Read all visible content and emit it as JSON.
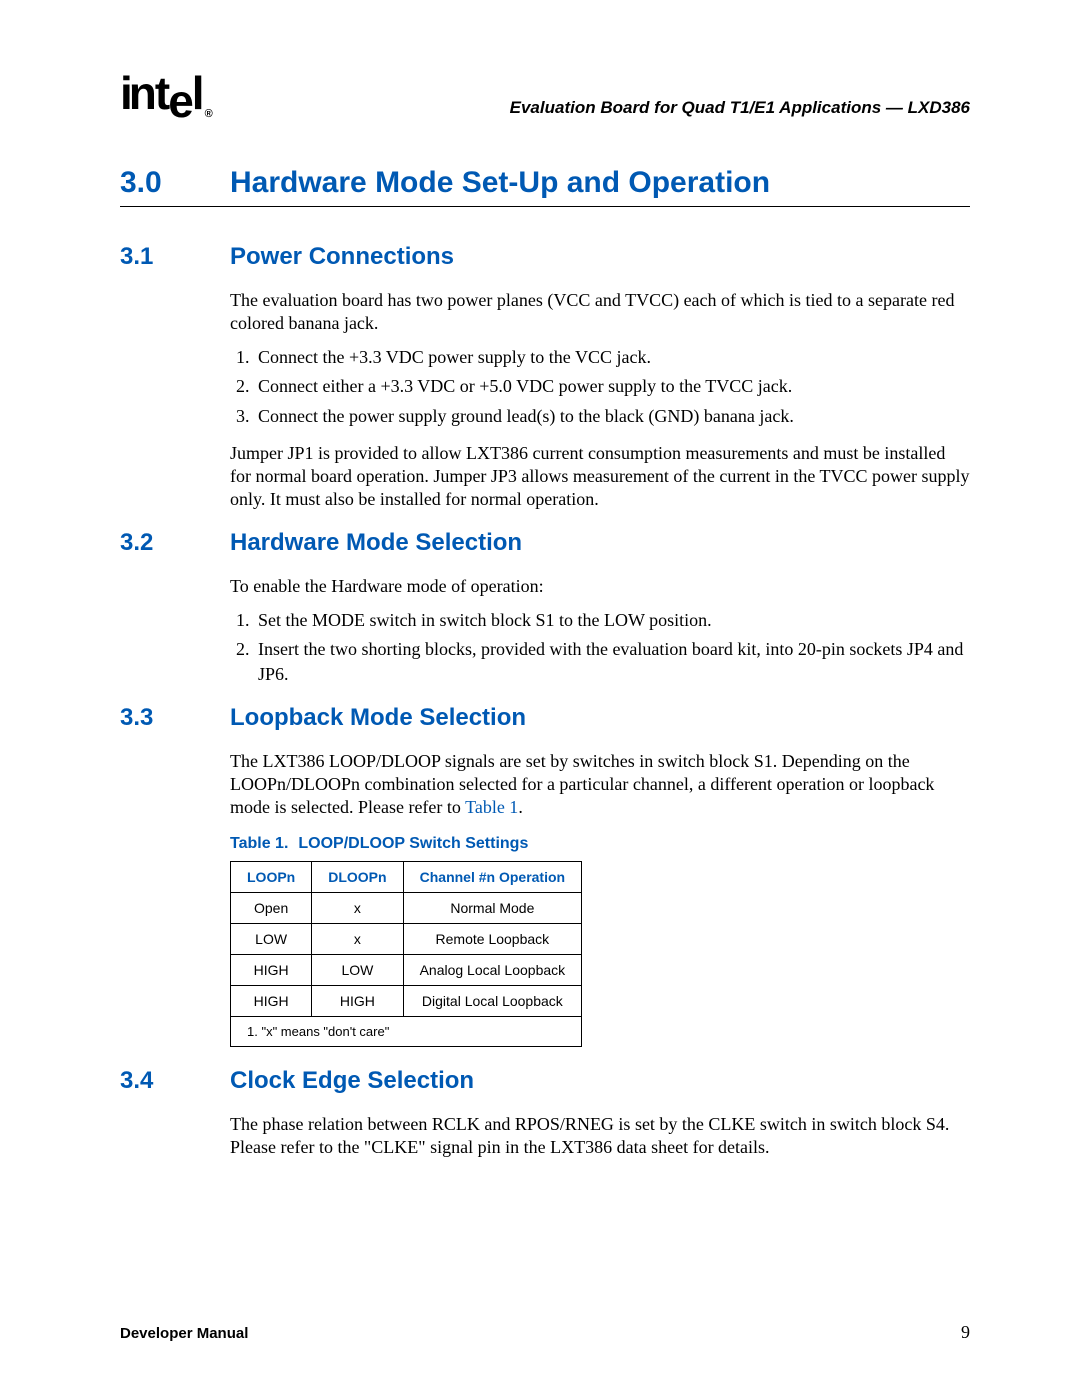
{
  "header": {
    "logo_text": "intel",
    "doc_label": "Evaluation Board for Quad T1/E1 Applications — LXD386"
  },
  "h1": {
    "num": "3.0",
    "title": "Hardware Mode Set-Up and Operation"
  },
  "s31": {
    "num": "3.1",
    "title": "Power Connections",
    "p1": "The evaluation board has two power planes (VCC and TVCC) each of which is tied to a separate red colored banana jack.",
    "steps": [
      "Connect the +3.3 VDC power supply to the VCC jack.",
      "Connect either a +3.3 VDC or +5.0 VDC power supply to the TVCC jack.",
      "Connect the power supply ground lead(s) to the black (GND) banana jack."
    ],
    "p2": "Jumper JP1 is provided to allow LXT386 current consumption measurements and must be installed for normal board operation. Jumper JP3 allows measurement of the current in the TVCC power supply only. It must also be installed for normal operation."
  },
  "s32": {
    "num": "3.2",
    "title": "Hardware Mode Selection",
    "p1": "To enable the Hardware mode of operation:",
    "steps": [
      "Set the MODE switch in switch block S1 to the LOW position.",
      "Insert the two shorting blocks, provided with the evaluation board kit, into 20-pin sockets JP4 and JP6."
    ]
  },
  "s33": {
    "num": "3.3",
    "title": "Loopback Mode Selection",
    "p1_a": "The LXT386 LOOP/DLOOP signals are set by switches in switch block S1. Depending on the LOOPn/DLOOPn combination selected for a particular channel, a different operation or loopback mode is selected. Please refer to ",
    "p1_link": "Table 1",
    "p1_b": ".",
    "table_caption_num": "Table 1.",
    "table_caption_title": "LOOP/DLOOP Switch Settings",
    "table": {
      "headers": [
        "LOOPn",
        "DLOOPn",
        "Channel #n Operation"
      ],
      "rows": [
        [
          "Open",
          "x",
          "Normal Mode"
        ],
        [
          "LOW",
          "x",
          "Remote Loopback"
        ],
        [
          "HIGH",
          "LOW",
          "Analog Local Loopback"
        ],
        [
          "HIGH",
          "HIGH",
          "Digital Local Loopback"
        ]
      ],
      "footnote": "1. \"x\" means \"don't care\""
    }
  },
  "s34": {
    "num": "3.4",
    "title": "Clock Edge Selection",
    "p1": "The phase relation between RCLK and RPOS/RNEG is set by the CLKE switch in switch block S4. Please refer to the \"CLKE\" signal pin in the LXT386 data sheet for details."
  },
  "footer": {
    "left": "Developer Manual",
    "page": "9"
  }
}
